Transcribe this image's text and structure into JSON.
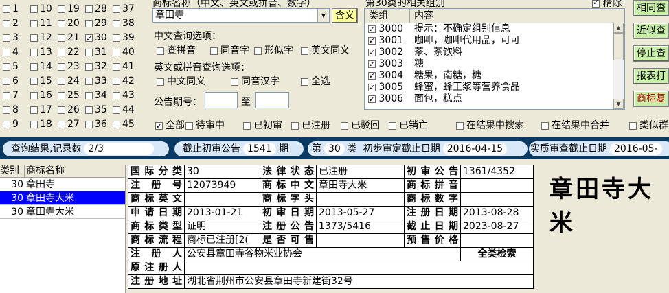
{
  "class_grid": [
    {
      "n": "1",
      "on": false
    },
    {
      "n": "10",
      "on": false
    },
    {
      "n": "19",
      "on": false
    },
    {
      "n": "28",
      "on": false
    },
    {
      "n": "37",
      "on": false
    },
    {
      "n": "2",
      "on": false
    },
    {
      "n": "11",
      "on": false
    },
    {
      "n": "20",
      "on": false
    },
    {
      "n": "29",
      "on": false
    },
    {
      "n": "38",
      "on": false
    },
    {
      "n": "3",
      "on": false
    },
    {
      "n": "12",
      "on": false
    },
    {
      "n": "21",
      "on": false
    },
    {
      "n": "30",
      "on": true
    },
    {
      "n": "39",
      "on": false
    },
    {
      "n": "4",
      "on": false
    },
    {
      "n": "13",
      "on": false
    },
    {
      "n": "22",
      "on": false
    },
    {
      "n": "31",
      "on": false
    },
    {
      "n": "40",
      "on": false
    },
    {
      "n": "5",
      "on": false
    },
    {
      "n": "14",
      "on": false
    },
    {
      "n": "23",
      "on": false
    },
    {
      "n": "32",
      "on": false
    },
    {
      "n": "41",
      "on": false
    },
    {
      "n": "6",
      "on": false
    },
    {
      "n": "15",
      "on": false
    },
    {
      "n": "24",
      "on": false
    },
    {
      "n": "33",
      "on": false
    },
    {
      "n": "42",
      "on": false
    },
    {
      "n": "7",
      "on": false
    },
    {
      "n": "16",
      "on": false
    },
    {
      "n": "25",
      "on": false
    },
    {
      "n": "34",
      "on": false
    },
    {
      "n": "43",
      "on": false
    },
    {
      "n": "8",
      "on": false
    },
    {
      "n": "17",
      "on": false
    },
    {
      "n": "26",
      "on": false
    },
    {
      "n": "35",
      "on": false
    },
    {
      "n": "44",
      "on": false
    },
    {
      "n": "9",
      "on": false
    },
    {
      "n": "18",
      "on": false
    },
    {
      "n": "27",
      "on": false
    },
    {
      "n": "36",
      "on": false
    },
    {
      "n": "45",
      "on": false
    }
  ],
  "search": {
    "top_label": "商标名称（中文、英文或拼音、数字）",
    "value": "章田寺",
    "meaning_button": "含义",
    "cn_options_label": "中文查询选项：",
    "cn_options": [
      "查拼音",
      "同音字",
      "形似字",
      "英文同义"
    ],
    "en_options_label": "英文或拼音查询选项：",
    "en_options": [
      "中文同义",
      "同音汉字",
      "全选"
    ],
    "gazette_label": "公告期号：",
    "gazette_from": "",
    "gazette_to_label": "至",
    "gazette_to": ""
  },
  "related": {
    "title": "第30类的相关组别",
    "precise_label": "精除",
    "col_group": "类组",
    "col_content": "内容",
    "rows": [
      {
        "code": "3000",
        "text": "提示：不确定组别信息",
        "on": true
      },
      {
        "code": "3001",
        "text": "咖啡，咖啡代用品，可可",
        "on": true
      },
      {
        "code": "3002",
        "text": "茶、茶饮料",
        "on": true
      },
      {
        "code": "3003",
        "text": "糖",
        "on": true
      },
      {
        "code": "3004",
        "text": "糖果，南糖，糖",
        "on": true
      },
      {
        "code": "3005",
        "text": "蜂蜜，蜂王浆等营养食品",
        "on": true
      },
      {
        "code": "3006",
        "text": "面包，糕点",
        "on": true
      }
    ]
  },
  "buttons": {
    "b1": "相同查",
    "b2": "近似查",
    "b3": "停止查",
    "b4": "报表打",
    "b5": "商标复"
  },
  "filters": [
    "全部",
    "待审中",
    "已初审",
    "已注册",
    "已驳回",
    "已销亡"
  ],
  "filters_checked": [
    true,
    false,
    false,
    false,
    false,
    false
  ],
  "search_in": [
    "在结果中搜索",
    "在结果中合并",
    "类似群"
  ],
  "status": {
    "result_label": "查询结果,记录数",
    "result_value": "2/3",
    "cutoff_label": "截止初审公告",
    "cutoff_value": "1541",
    "cutoff_unit": "期",
    "class_prefix": "第",
    "class_value": "30",
    "class_suffix": "类",
    "initial_label": "初步审定截止日期",
    "initial_date": "2016-04-15",
    "subst_label": "实质审查截止日期",
    "subst_date": "2016-05-"
  },
  "result_list": {
    "col_class": "类别",
    "col_name": "商标名称",
    "rows": [
      {
        "cls": "30",
        "name": "章田寺",
        "sel": false
      },
      {
        "cls": "30",
        "name": "章田寺大米",
        "sel": true
      },
      {
        "cls": "30",
        "name": "章田寺大米",
        "sel": false
      }
    ]
  },
  "detail": {
    "intl_class_l": "国际分类",
    "intl_class": "30",
    "legal_status_l": "法律状态",
    "legal_status": "已注册",
    "first_notice_l": "初审公告",
    "first_notice": "1361/4352",
    "reg_no_l": "注 册 号",
    "reg_no": "12073949",
    "cn_name_l": "商标中文",
    "cn_name": "章田寺大米",
    "pinyin_l": "商标拼音",
    "pinyin": "",
    "en_name_l": "商标英文",
    "en_name": "",
    "initial_l": "商标字头",
    "initial": "",
    "digits_l": "商标数字",
    "digits": "",
    "apply_date_l": "申请日期",
    "apply_date": "2013-01-21",
    "first_date_l": "初审日期",
    "first_date": "2013-05-27",
    "reg_date_l": "注册日期",
    "reg_date": "2013-08-28",
    "type_l": "商标类型",
    "type": "证明",
    "reg_notice_l": "注册公告",
    "reg_notice": "1373/5416",
    "expire_l": "截止日期",
    "expire": "2023-08-27",
    "flow_l": "商标流程",
    "flow": "商标已注册[2(",
    "for_sale_l": "是否可售",
    "for_sale": "",
    "presale_l": "预售价格",
    "presale": "",
    "registrant_l": "注 册 人",
    "registrant": "公安县章田寺谷物米业协会",
    "all_class_search": "全类检索",
    "orig_registrant_l": "原注册人",
    "orig_registrant": "",
    "address_l": "注册地址",
    "address": "湖北省荆州市公安县章田寺新建街32号"
  },
  "signature": "章田寺大米"
}
